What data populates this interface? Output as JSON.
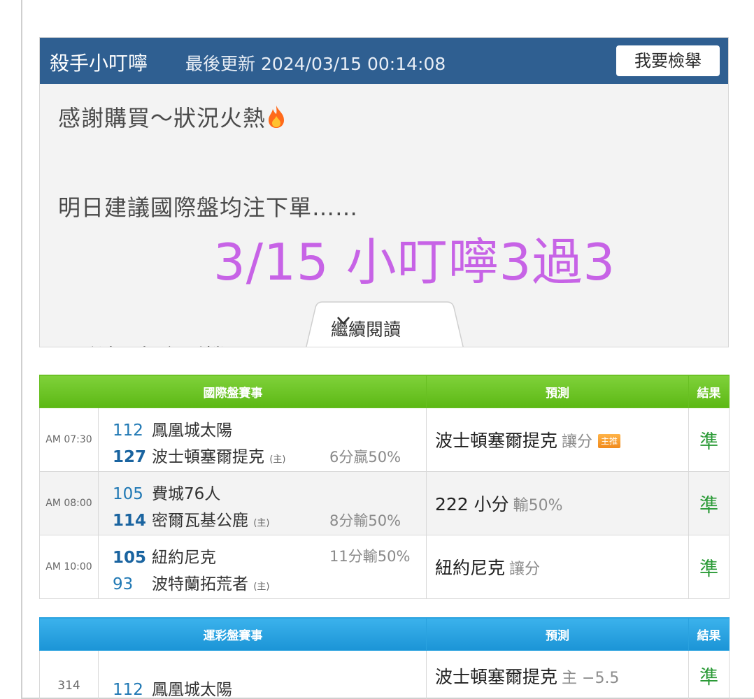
{
  "article": {
    "author": "殺手小叮嚀",
    "updated": "最後更新 2024/03/15 00:14:08",
    "report_label": "我要檢舉",
    "line1": "感謝購買～狀況火熱",
    "line2": "明日建議國際盤均注下單……",
    "line3": "運彩盤 有介到機再下單！",
    "watermark": "3/15 小叮嚀3過3",
    "read_more": "繼續閱讀"
  },
  "intl_table": {
    "headers": [
      "國際盤賽事",
      "預測",
      "結果"
    ],
    "rows": [
      {
        "time": "AM 07:30",
        "away_score": "112",
        "away_team": "鳳凰城太陽",
        "home_score": "127",
        "home_team": "波士頓塞爾提克",
        "home_mark": "(主)",
        "odds": "6分贏50%",
        "pred_main": "波士頓塞爾提克",
        "pred_sub": "讓分",
        "pred_tag": "主推",
        "result": "準"
      },
      {
        "time": "AM 08:00",
        "away_score": "105",
        "away_team": "費城76人",
        "home_score": "114",
        "home_team": "密爾瓦基公鹿",
        "home_mark": "(主)",
        "odds": "8分輸50%",
        "pred_main": "222 小分",
        "pred_sub": "輸50%",
        "result": "準"
      },
      {
        "time": "AM 10:00",
        "away_score": "105",
        "away_team": "紐約尼克",
        "home_score": "93",
        "home_team": "波特蘭拓荒者",
        "home_mark": "(主)",
        "odds": "11分輸50%",
        "pred_main": "紐約尼克",
        "pred_sub": "讓分",
        "result": "準"
      }
    ]
  },
  "sport_table": {
    "headers": [
      "運彩盤賽事",
      "預測",
      "結果"
    ],
    "rows": [
      {
        "time": "314",
        "away_score": "112",
        "away_team": "鳳凰城太陽",
        "pred_main": "波士頓塞爾提克",
        "pred_sub": "主 −5.5",
        "result": "準"
      }
    ]
  },
  "colors": {
    "header_blue": "#2f5f91",
    "intl_green": "#5cb814",
    "sport_blue": "#1b94d6",
    "result_green": "#2a9a36",
    "watermark_purple": "#c763e6"
  }
}
